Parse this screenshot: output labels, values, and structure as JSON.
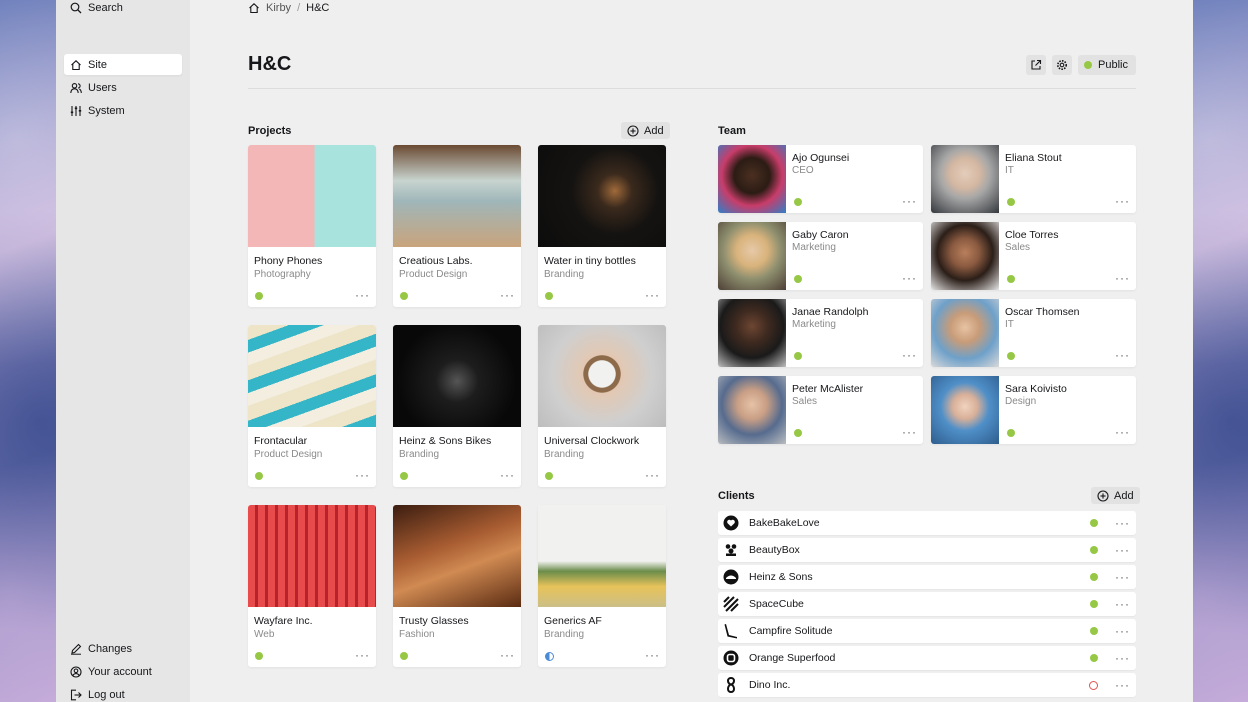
{
  "sidebar": {
    "search": "Search",
    "nav": [
      {
        "label": "Site",
        "icon": "home-icon"
      },
      {
        "label": "Users",
        "icon": "users-icon"
      },
      {
        "label": "System",
        "icon": "settings-sliders-icon"
      }
    ],
    "bottom": [
      {
        "label": "Changes",
        "icon": "edit-icon"
      },
      {
        "label": "Your account",
        "icon": "account-icon"
      },
      {
        "label": "Log out",
        "icon": "logout-icon"
      }
    ]
  },
  "breadcrumb": {
    "root": "Kirby",
    "current": "H&C"
  },
  "header": {
    "title": "H&C",
    "status_label": "Public",
    "status_color": "#96c846"
  },
  "projects": {
    "label": "Projects",
    "add_label": "Add",
    "items": [
      {
        "title": "Phony Phones",
        "category": "Photography",
        "status": "listed"
      },
      {
        "title": "Creatious Labs.",
        "category": "Product Design",
        "status": "listed"
      },
      {
        "title": "Water in tiny bottles",
        "category": "Branding",
        "status": "listed"
      },
      {
        "title": "Frontacular",
        "category": "Product Design",
        "status": "listed"
      },
      {
        "title": "Heinz & Sons Bikes",
        "category": "Branding",
        "status": "listed"
      },
      {
        "title": "Universal Clockwork",
        "category": "Branding",
        "status": "listed"
      },
      {
        "title": "Wayfare Inc.",
        "category": "Web",
        "status": "listed"
      },
      {
        "title": "Trusty Glasses",
        "category": "Fashion",
        "status": "listed"
      },
      {
        "title": "Generics AF",
        "category": "Branding",
        "status": "unlisted"
      }
    ]
  },
  "team": {
    "label": "Team",
    "members": [
      {
        "name": "Ajo Ogunsei",
        "role": "CEO"
      },
      {
        "name": "Eliana Stout",
        "role": "IT"
      },
      {
        "name": "Gaby Caron",
        "role": "Marketing"
      },
      {
        "name": "Cloe Torres",
        "role": "Sales"
      },
      {
        "name": "Janae Randolph",
        "role": "Marketing"
      },
      {
        "name": "Oscar Thomsen",
        "role": "IT"
      },
      {
        "name": "Peter McAlister",
        "role": "Sales"
      },
      {
        "name": "Sara Koivisto",
        "role": "Design"
      }
    ]
  },
  "clients": {
    "label": "Clients",
    "add_label": "Add",
    "items": [
      {
        "name": "BakeBakeLove",
        "status": "listed"
      },
      {
        "name": "BeautyBox",
        "status": "listed"
      },
      {
        "name": "Heinz & Sons",
        "status": "listed"
      },
      {
        "name": "SpaceCube",
        "status": "listed"
      },
      {
        "name": "Campfire Solitude",
        "status": "listed"
      },
      {
        "name": "Orange Superfood",
        "status": "listed"
      },
      {
        "name": "Dino Inc.",
        "status": "draft"
      }
    ]
  },
  "colors": {
    "listed": "#96c846",
    "draft": "#e05252",
    "unlisted": "#4a8bd6"
  }
}
